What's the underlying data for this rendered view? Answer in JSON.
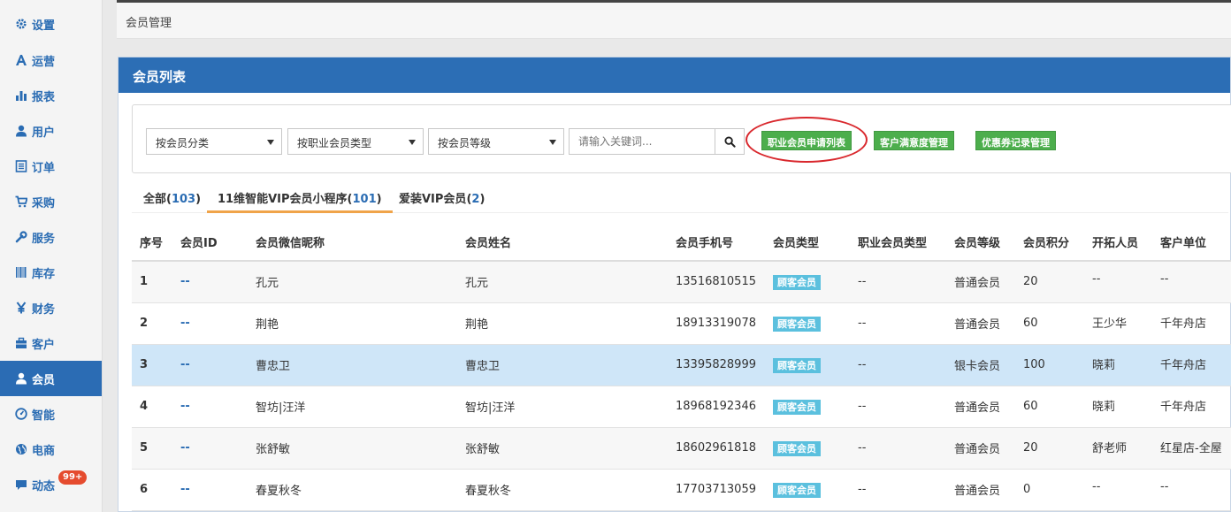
{
  "sidebar": {
    "items": [
      {
        "label": "设置",
        "icon": "gear-icon"
      },
      {
        "label": "运营",
        "icon": "font-a-icon"
      },
      {
        "label": "报表",
        "icon": "bar-chart-icon"
      },
      {
        "label": "用户",
        "icon": "user-icon"
      },
      {
        "label": "订单",
        "icon": "list-icon"
      },
      {
        "label": "采购",
        "icon": "cart-icon"
      },
      {
        "label": "服务",
        "icon": "wrench-icon"
      },
      {
        "label": "库存",
        "icon": "barcode-icon"
      },
      {
        "label": "财务",
        "icon": "yen-icon"
      },
      {
        "label": "客户",
        "icon": "briefcase-icon"
      },
      {
        "label": "会员",
        "icon": "user-icon",
        "active": true
      },
      {
        "label": "智能",
        "icon": "dashboard-icon"
      },
      {
        "label": "电商",
        "icon": "globe-icon"
      },
      {
        "label": "动态",
        "icon": "comment-icon",
        "badge": "99+"
      }
    ]
  },
  "breadcrumb": "会员管理",
  "panel_title": "会员列表",
  "filters": {
    "member_category": "按会员分类",
    "professional_type": "按职业会员类型",
    "member_level": "按会员等级",
    "search_placeholder": "请输入关键词..."
  },
  "actions": {
    "apply_list": "职业会员申请列表",
    "satisfaction": "客户满意度管理",
    "coupon_records": "优惠券记录管理"
  },
  "tabs": [
    {
      "label": "全部",
      "count": "103"
    },
    {
      "label": "11维智能VIP会员小程序",
      "count": "101",
      "active": true
    },
    {
      "label": "爱装VIP会员",
      "count": "2"
    }
  ],
  "table": {
    "headers": [
      "序号",
      "会员ID",
      "会员微信昵称",
      "会员姓名",
      "会员手机号",
      "会员类型",
      "职业会员类型",
      "会员等级",
      "会员积分",
      "开拓人员",
      "客户单位"
    ],
    "rows": [
      {
        "seq": "1",
        "id": "--",
        "nickname": "孔元",
        "name": "孔元",
        "phone": "13516810515",
        "type": "顾客会员",
        "pro_type": "--",
        "level": "普通会员",
        "points": "20",
        "developer": "--",
        "unit": "--"
      },
      {
        "seq": "2",
        "id": "--",
        "nickname": "荆艳",
        "name": "荆艳",
        "phone": "18913319078",
        "type": "顾客会员",
        "pro_type": "--",
        "level": "普通会员",
        "points": "60",
        "developer": "王少华",
        "unit": "千年舟店"
      },
      {
        "seq": "3",
        "id": "--",
        "nickname": "曹忠卫",
        "name": "曹忠卫",
        "phone": "13395828999",
        "type": "顾客会员",
        "pro_type": "--",
        "level": "银卡会员",
        "points": "100",
        "developer": "晓莉",
        "unit": "千年舟店"
      },
      {
        "seq": "4",
        "id": "--",
        "nickname": "智坊|汪洋",
        "name": "智坊|汪洋",
        "phone": "18968192346",
        "type": "顾客会员",
        "pro_type": "--",
        "level": "普通会员",
        "points": "60",
        "developer": "晓莉",
        "unit": "千年舟店"
      },
      {
        "seq": "5",
        "id": "--",
        "nickname": "张舒敏",
        "name": "张舒敏",
        "phone": "18602961818",
        "type": "顾客会员",
        "pro_type": "--",
        "level": "普通会员",
        "points": "20",
        "developer": "舒老师",
        "unit": "红星店-全屋"
      },
      {
        "seq": "6",
        "id": "--",
        "nickname": "春夏秋冬",
        "name": "春夏秋冬",
        "phone": "17703713059",
        "type": "顾客会员",
        "pro_type": "--",
        "level": "普通会员",
        "points": "0",
        "developer": "--",
        "unit": "--"
      }
    ]
  },
  "colors": {
    "primary": "#2c6eb5",
    "success": "#4cae4c",
    "info_tag": "#5bc0de",
    "highlight_row": "#cfe6f8",
    "annotation": "#d9282d",
    "tab_underline": "#f0a449"
  }
}
